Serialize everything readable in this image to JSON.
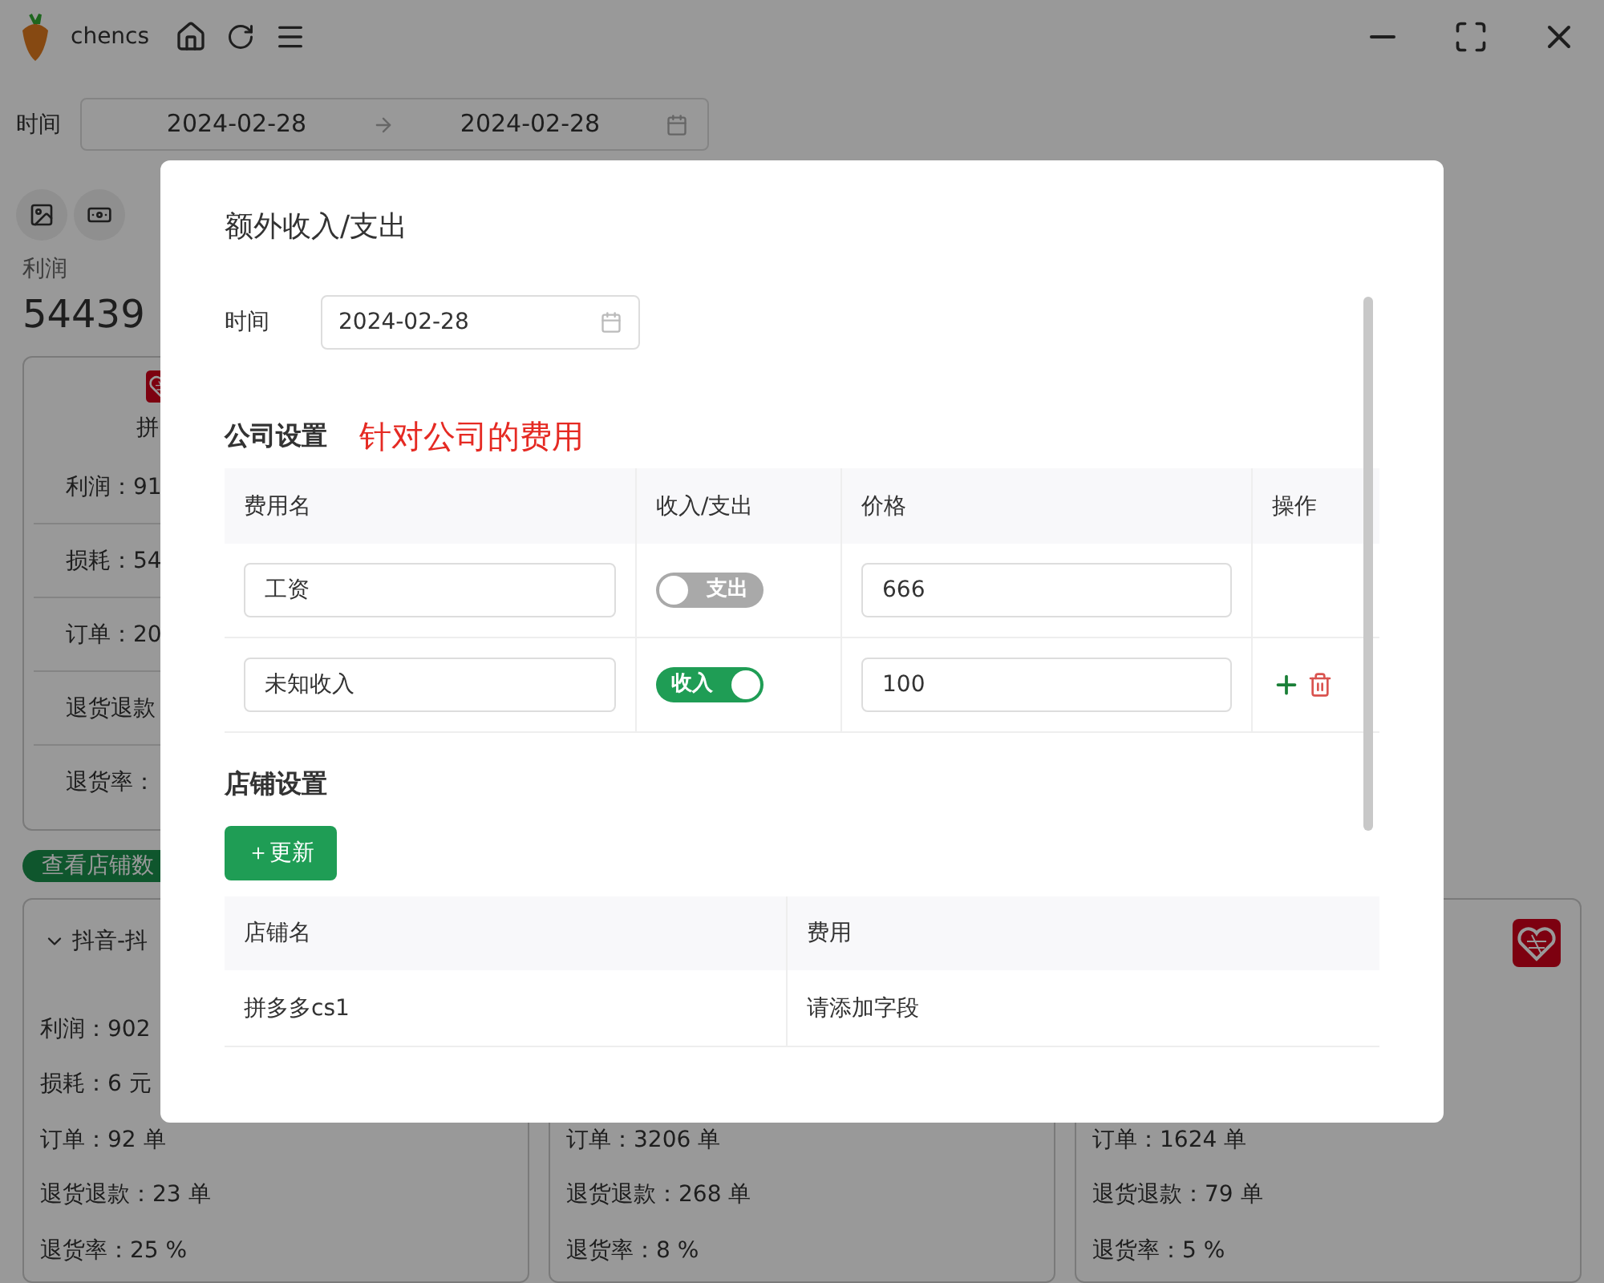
{
  "app": {
    "user": "chencs"
  },
  "filter": {
    "label": "时间",
    "start": "2024-02-28",
    "end": "2024-02-28"
  },
  "summary": {
    "label": "利润",
    "value": "54439"
  },
  "top_card": {
    "name": "拼",
    "rows": [
      {
        "label": "利润：",
        "value": "91"
      },
      {
        "label": "损耗：",
        "value": "54"
      },
      {
        "label": "订单：",
        "value": "20"
      },
      {
        "label": "退货退款",
        "value": ""
      },
      {
        "label": "退货率：",
        "value": ""
      }
    ]
  },
  "view_shops_button": "查看店铺数",
  "shop_cards": [
    {
      "title": "抖音-抖",
      "rows": [
        "利润：902",
        "损耗：6 元",
        "订单：92 单",
        "退货退款：23 单",
        "退货率：25 %"
      ]
    },
    {
      "rows": [
        "订单：3206 单",
        "退货退款：268 单",
        "退货率：8 %"
      ]
    },
    {
      "logo": true,
      "rows": [
        "订单：1624 单",
        "退货退款：79 单",
        "退货率：5 %"
      ]
    }
  ],
  "dialog": {
    "title": "额外收入/支出",
    "date_label": "时间",
    "date": "2024-02-28",
    "company": {
      "title": "公司设置",
      "note": "针对公司的费用",
      "columns": [
        "费用名",
        "收入/支出",
        "价格",
        "操作"
      ],
      "rows": [
        {
          "name": "工资",
          "toggle": {
            "on": false,
            "label": "支出"
          },
          "price": "666",
          "actions": false
        },
        {
          "name": "未知收入",
          "toggle": {
            "on": true,
            "label": "收入"
          },
          "price": "100",
          "actions": true
        }
      ]
    },
    "shops": {
      "title": "店铺设置",
      "button": "＋更新",
      "columns": [
        "店铺名",
        "费用"
      ],
      "rows": [
        {
          "name": "拼多多cs1",
          "fee": "请添加字段"
        }
      ]
    }
  }
}
